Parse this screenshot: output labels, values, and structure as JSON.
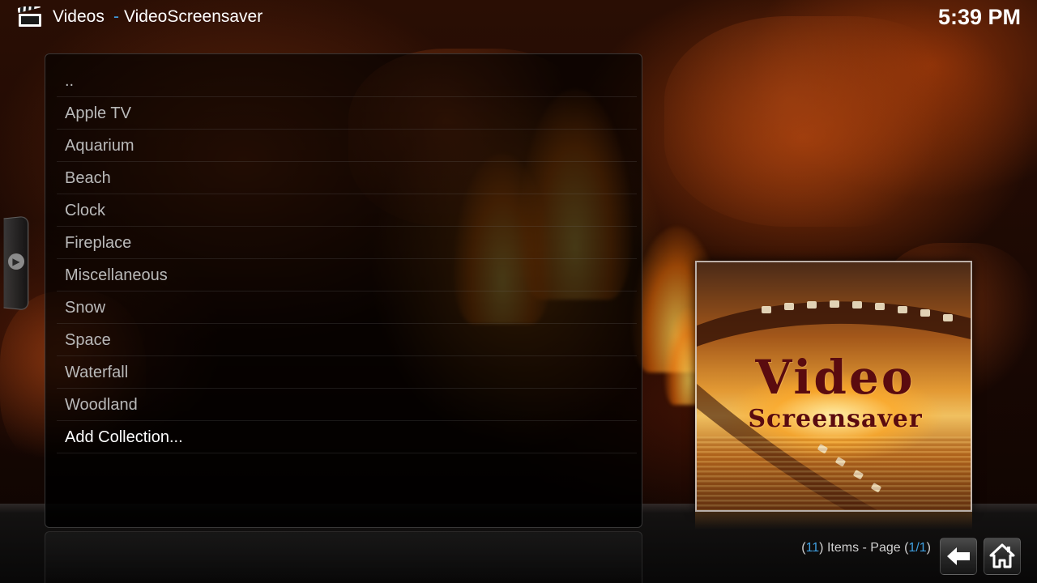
{
  "header": {
    "section": "Videos",
    "separator": "-",
    "path": "VideoScreensaver",
    "clock": "5:39 PM"
  },
  "list": {
    "items": [
      {
        "label": ".."
      },
      {
        "label": "Apple TV"
      },
      {
        "label": "Aquarium"
      },
      {
        "label": "Beach"
      },
      {
        "label": "Clock"
      },
      {
        "label": "Fireplace"
      },
      {
        "label": "Miscellaneous"
      },
      {
        "label": "Snow"
      },
      {
        "label": "Space"
      },
      {
        "label": "Waterfall"
      },
      {
        "label": "Woodland"
      },
      {
        "label": "Add Collection..."
      }
    ]
  },
  "thumbnail": {
    "line1": "Video",
    "line2": "Screensaver"
  },
  "footer": {
    "open_paren": "(",
    "item_count": "11",
    "items_text": ") Items - Page (",
    "page": "1/1",
    "close_paren": ")"
  },
  "icons": {
    "header_icon": "clapperboard-icon",
    "side_tab_icon": "chevron-right-icon",
    "back_icon": "arrow-left-icon",
    "home_icon": "home-icon"
  },
  "colors": {
    "accent": "#3f9fe0",
    "text_primary": "#ffffff",
    "text_list": "#b9b9b9"
  }
}
